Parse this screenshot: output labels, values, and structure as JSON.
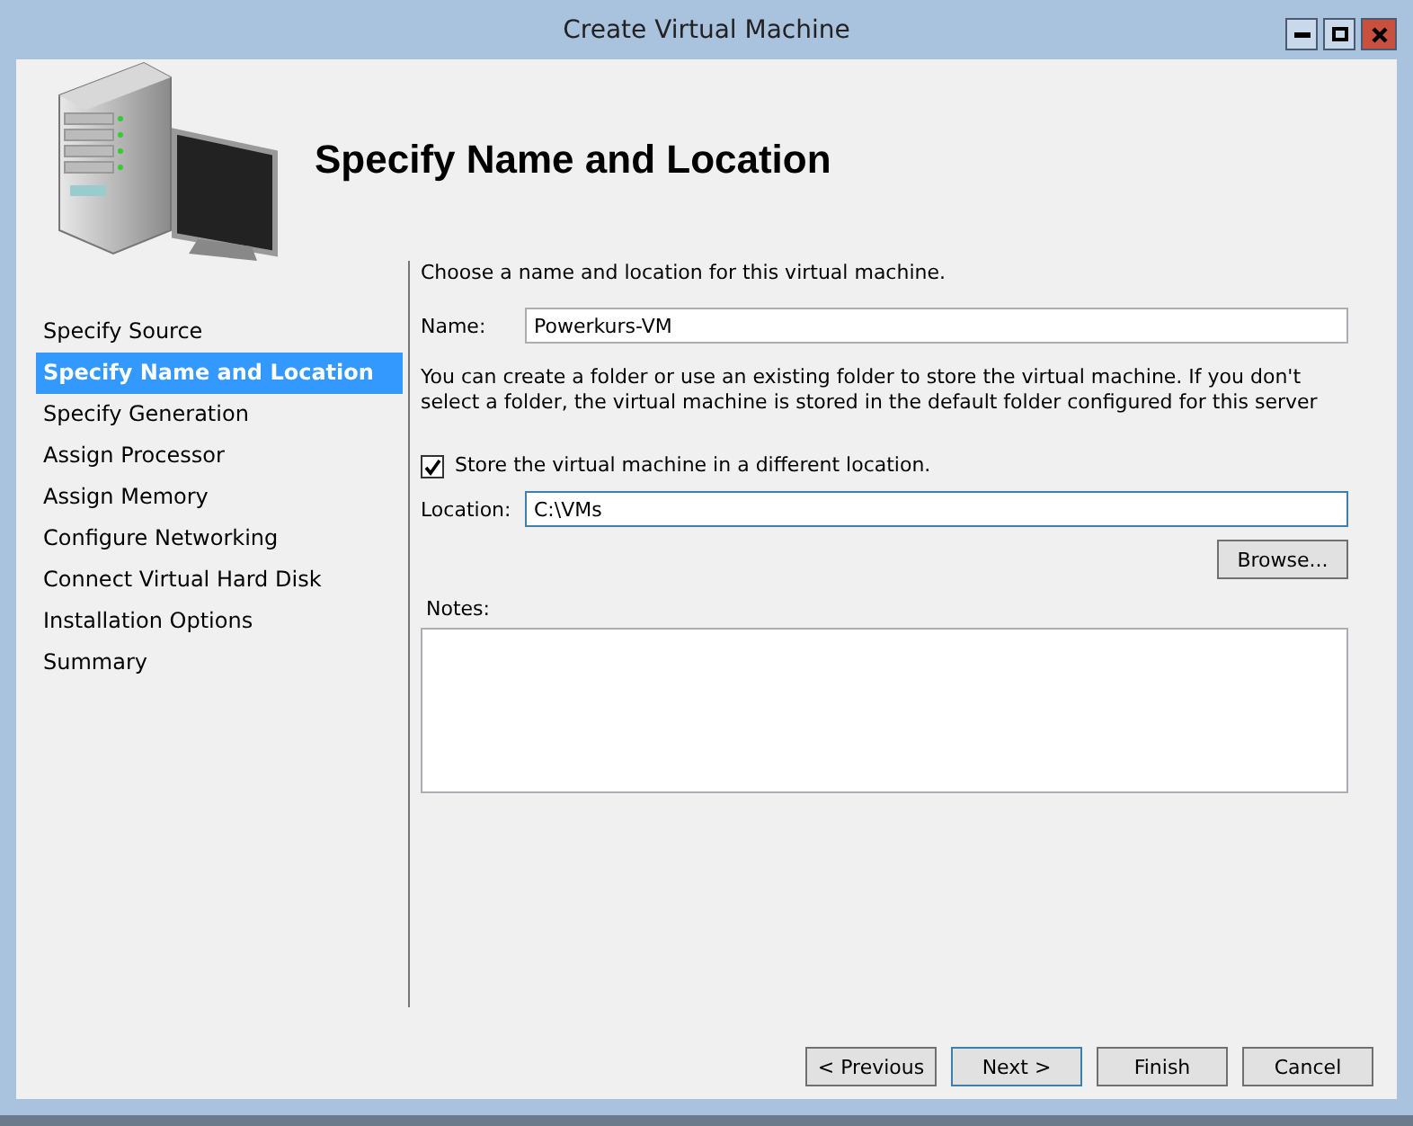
{
  "window": {
    "title": "Create Virtual Machine"
  },
  "page_title": "Specify Name and Location",
  "steps": [
    {
      "label": "Specify Source",
      "selected": false
    },
    {
      "label": "Specify Name and Location",
      "selected": true
    },
    {
      "label": "Specify Generation",
      "selected": false
    },
    {
      "label": "Assign Processor",
      "selected": false
    },
    {
      "label": "Assign Memory",
      "selected": false
    },
    {
      "label": "Configure Networking",
      "selected": false
    },
    {
      "label": "Connect Virtual Hard Disk",
      "selected": false
    },
    {
      "label": "Installation Options",
      "selected": false
    },
    {
      "label": "Summary",
      "selected": false
    }
  ],
  "intro": "Choose a name and location for this virtual machine.",
  "name_field": {
    "label": "Name:",
    "value": "Powerkurs-VM"
  },
  "folder_hint": "You can create a folder or use an existing folder to store the virtual machine. If you don't select a folder, the virtual machine is stored in the default folder configured for this server",
  "store_checkbox": {
    "label": "Store the virtual machine in a different location.",
    "checked": true
  },
  "location_field": {
    "label": "Location:",
    "value": "C:\\VMs",
    "focused": true
  },
  "browse_button": "Browse...",
  "notes": {
    "label": "Notes:"
  },
  "buttons": [
    {
      "label": "< Previous",
      "default": false
    },
    {
      "label": "Next >",
      "default": true
    },
    {
      "label": "Finish",
      "default": false
    },
    {
      "label": "Cancel",
      "default": false
    }
  ]
}
